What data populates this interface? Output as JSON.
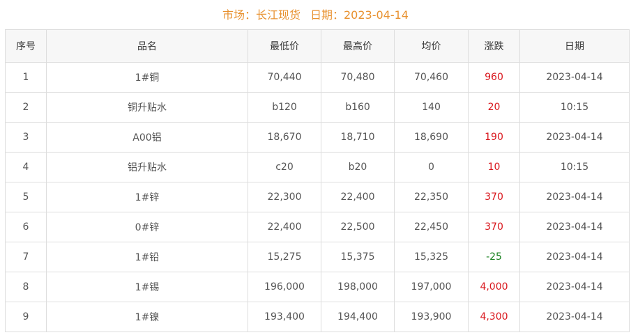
{
  "header": {
    "market_label": "市场：长江现货",
    "date_label": "日期：2023-04-14"
  },
  "table": {
    "columns": [
      "序号",
      "品名",
      "最低价",
      "最高价",
      "均价",
      "涨跌",
      "日期"
    ],
    "rows": [
      {
        "no": "1",
        "name": "1#铜",
        "low": "70,440",
        "high": "70,480",
        "avg": "70,460",
        "change": "960",
        "direction": "up",
        "date": "2023-04-14"
      },
      {
        "no": "2",
        "name": "铜升贴水",
        "low": "b120",
        "high": "b160",
        "avg": "140",
        "change": "20",
        "direction": "up",
        "date": "10:15"
      },
      {
        "no": "3",
        "name": "A00铝",
        "low": "18,670",
        "high": "18,710",
        "avg": "18,690",
        "change": "190",
        "direction": "up",
        "date": "2023-04-14"
      },
      {
        "no": "4",
        "name": "铝升贴水",
        "low": "c20",
        "high": "b20",
        "avg": "0",
        "change": "10",
        "direction": "up",
        "date": "10:15"
      },
      {
        "no": "5",
        "name": "1#锌",
        "low": "22,300",
        "high": "22,400",
        "avg": "22,350",
        "change": "370",
        "direction": "up",
        "date": "2023-04-14"
      },
      {
        "no": "6",
        "name": "0#锌",
        "low": "22,400",
        "high": "22,500",
        "avg": "22,450",
        "change": "370",
        "direction": "up",
        "date": "2023-04-14"
      },
      {
        "no": "7",
        "name": "1#铅",
        "low": "15,275",
        "high": "15,375",
        "avg": "15,325",
        "change": "-25",
        "direction": "down",
        "date": "2023-04-14"
      },
      {
        "no": "8",
        "name": "1#锡",
        "low": "196,000",
        "high": "198,000",
        "avg": "197,000",
        "change": "4,000",
        "direction": "up",
        "date": "2023-04-14"
      },
      {
        "no": "9",
        "name": "1#镍",
        "low": "193,400",
        "high": "194,400",
        "avg": "193,900",
        "change": "4,300",
        "direction": "up",
        "date": "2023-04-14"
      }
    ]
  },
  "colors": {
    "title": "#e8912f",
    "up": "#d9161c",
    "down": "#18801f",
    "header_bg": "#f7f7f7",
    "border": "#dddddd"
  }
}
